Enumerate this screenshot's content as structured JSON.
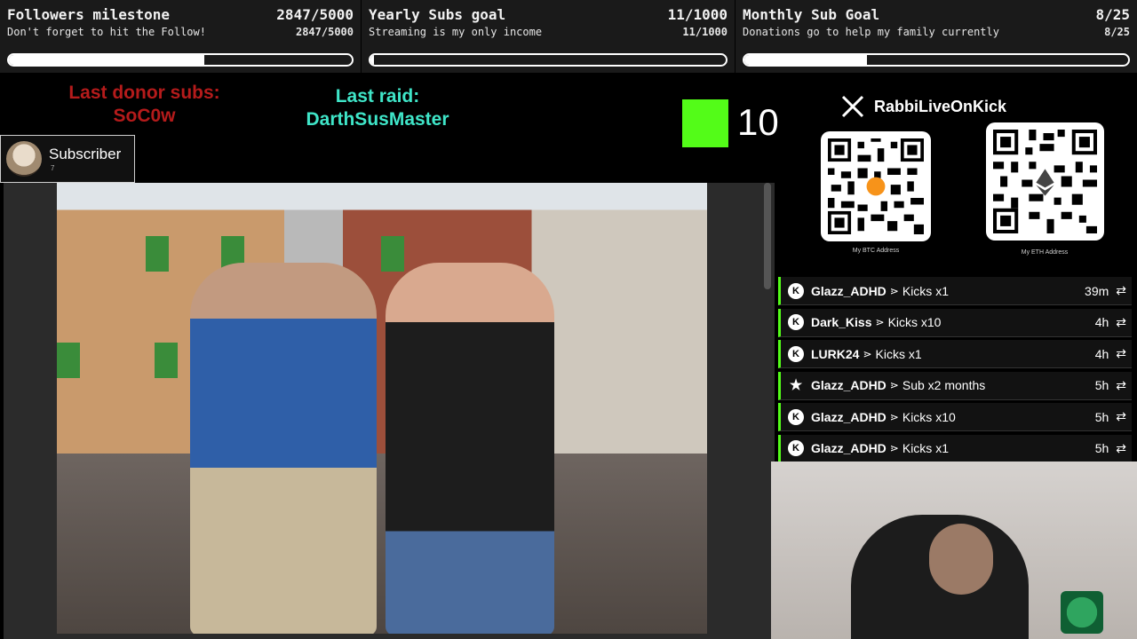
{
  "goals": [
    {
      "title": "Followers milestone",
      "count": "2847/5000",
      "subtitle": "Don't forget to hit the Follow!",
      "count_sub": "2847/5000",
      "progress": 0.569
    },
    {
      "title": "Yearly Subs goal",
      "count": "11/1000",
      "subtitle": "Streaming is my only income",
      "count_sub": "11/1000",
      "progress": 0.011
    },
    {
      "title": "Monthly Sub Goal",
      "count": "8/25",
      "subtitle": "Donations go to help my family currently",
      "count_sub": "8/25",
      "progress": 0.32
    }
  ],
  "last_donor": {
    "label": "Last donor subs:",
    "name": "SoC0w"
  },
  "last_raid": {
    "label": "Last raid:",
    "name": "DarthSusMaster"
  },
  "subscriber_badge": {
    "label": "Subscriber",
    "count": "7"
  },
  "kick": {
    "count": "10",
    "color": "#53fc18"
  },
  "social": {
    "handle": "RabbiLiveOnKick"
  },
  "qr": {
    "btc_caption": "My BTC Address",
    "eth_caption": "My ETH Address"
  },
  "alerts": [
    {
      "user": "Glazz_ADHD",
      "what": "Kicks x1",
      "time": "39m",
      "icon": "kick-icon"
    },
    {
      "user": "Dark_Kiss",
      "what": "Kicks x10",
      "time": "4h",
      "icon": "kick-icon"
    },
    {
      "user": "LURK24",
      "what": "Kicks x1",
      "time": "4h",
      "icon": "kick-icon"
    },
    {
      "user": "Glazz_ADHD",
      "what": "Sub x2 months",
      "time": "5h",
      "icon": "star-icon"
    },
    {
      "user": "Glazz_ADHD",
      "what": "Kicks x10",
      "time": "5h",
      "icon": "kick-icon"
    },
    {
      "user": "Glazz_ADHD",
      "what": "Kicks x1",
      "time": "5h",
      "icon": "kick-icon"
    }
  ],
  "colors": {
    "donor": "#b51b1b",
    "raid": "#3fe5c8",
    "accent": "#53fc18"
  }
}
